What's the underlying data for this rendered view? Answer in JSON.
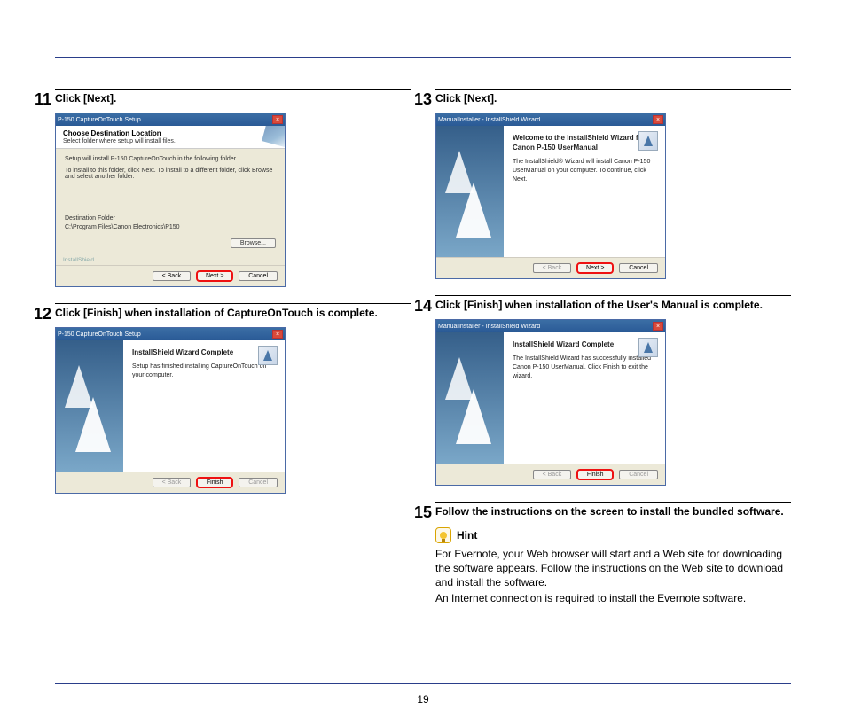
{
  "page_number": "19",
  "left": {
    "step11": {
      "num": "11",
      "text": "Click [Next].",
      "shot": {
        "title": "P-150 CaptureOnTouch Setup",
        "header1": "Choose Destination Location",
        "header2": "Select folder where setup will install files.",
        "line1": "Setup will install P-150 CaptureOnTouch in the following folder.",
        "line2": "To install to this folder, click Next. To install to a different folder, click Browse and select another folder.",
        "dest_label": "Destination Folder",
        "dest_path": "C:\\Program Files\\Canon Electronics\\P150",
        "browse": "Browse...",
        "brand": "InstallShield",
        "back": "< Back",
        "next": "Next >",
        "cancel": "Cancel"
      }
    },
    "step12": {
      "num": "12",
      "text": "Click [Finish] when installation of CaptureOnTouch is complete.",
      "shot": {
        "title": "P-150 CaptureOnTouch Setup",
        "wtitle": "InstallShield Wizard Complete",
        "wpara": "Setup has finished installing CaptureOnTouch on your computer.",
        "back": "< Back",
        "finish": "Finish",
        "cancel": "Cancel"
      }
    }
  },
  "right": {
    "step13": {
      "num": "13",
      "text": "Click [Next].",
      "shot": {
        "title": "ManualInstaller - InstallShield Wizard",
        "wtitle": "Welcome to the InstallShield Wizard for Canon P-150 UserManual",
        "wpara": "The InstallShield® Wizard will install Canon P-150 UserManual on your computer. To continue, click Next.",
        "back": "< Back",
        "next": "Next >",
        "cancel": "Cancel"
      }
    },
    "step14": {
      "num": "14",
      "text": "Click [Finish] when installation of the User's Manual is complete.",
      "shot": {
        "title": "ManualInstaller - InstallShield Wizard",
        "wtitle": "InstallShield Wizard Complete",
        "wpara": "The InstallShield Wizard has successfully installed Canon P-150 UserManual. Click Finish to exit the wizard.",
        "back": "< Back",
        "finish": "Finish",
        "cancel": "Cancel"
      }
    },
    "step15": {
      "num": "15",
      "text": "Follow the instructions on the screen to install the bundled software.",
      "hint_label": "Hint",
      "hint_body1": "For Evernote, your Web browser will start and a Web site for downloading the software appears. Follow the instructions on the Web site to download and install the software.",
      "hint_body2": "An Internet connection is required to install the Evernote software."
    }
  }
}
